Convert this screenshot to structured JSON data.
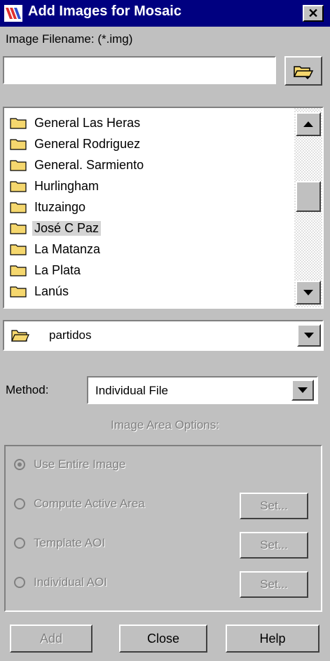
{
  "window": {
    "title": "Add Images for Mosaic",
    "close_symbol": "✕"
  },
  "filename": {
    "label": "Image Filename: (*.img)",
    "value": ""
  },
  "file_list": {
    "items": [
      {
        "label": "General Las Heras",
        "selected": false
      },
      {
        "label": "General Rodriguez",
        "selected": false
      },
      {
        "label": "General. Sarmiento",
        "selected": false
      },
      {
        "label": "Hurlingham",
        "selected": false
      },
      {
        "label": "Ituzaingo",
        "selected": false
      },
      {
        "label": "José C Paz",
        "selected": true
      },
      {
        "label": "La Matanza",
        "selected": false
      },
      {
        "label": "La Plata",
        "selected": false
      },
      {
        "label": "Lanús",
        "selected": false
      }
    ]
  },
  "directory": {
    "value": "partidos"
  },
  "method": {
    "label": "Method:",
    "value": "Individual File"
  },
  "options": {
    "heading": "Image Area Options:",
    "radios": [
      {
        "label": "Use Entire Image",
        "checked": true,
        "set_label": ""
      },
      {
        "label": "Compute Active Area",
        "checked": false,
        "set_label": "Set..."
      },
      {
        "label": "Template AOI",
        "checked": false,
        "set_label": "Set..."
      },
      {
        "label": "Individual AOI",
        "checked": false,
        "set_label": "Set..."
      }
    ]
  },
  "buttons": {
    "add": "Add",
    "close": "Close",
    "help": "Help"
  },
  "colors": {
    "titlebar": "#000080",
    "face": "#c0c0c0",
    "folder": "#f5d76e"
  }
}
